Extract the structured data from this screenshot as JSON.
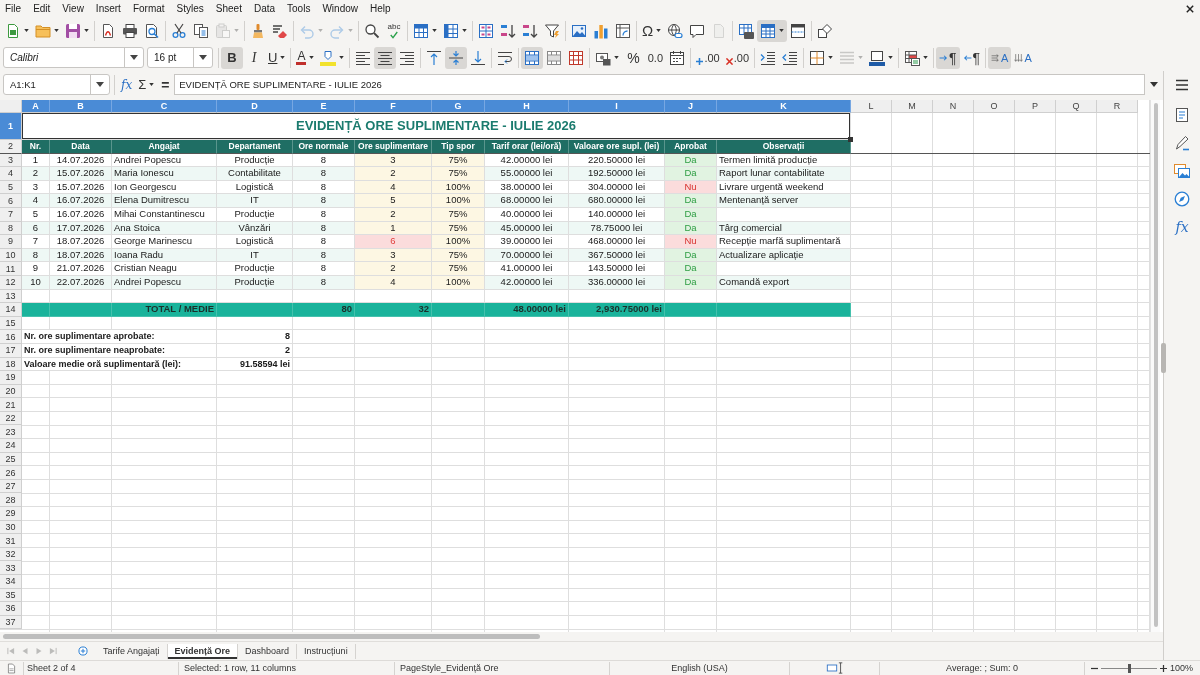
{
  "menu_bar": [
    "File",
    "Edit",
    "View",
    "Insert",
    "Format",
    "Styles",
    "Sheet",
    "Data",
    "Tools",
    "Window",
    "Help"
  ],
  "standard_toolbar": {
    "groups": [
      [
        {
          "kind": "new",
          "dropdown": true,
          "active": false,
          "disabled": false
        },
        {
          "kind": "open",
          "dropdown": true,
          "active": false,
          "disabled": false
        },
        {
          "kind": "save",
          "dropdown": true,
          "active": false,
          "disabled": false
        }
      ],
      [
        {
          "kind": "export",
          "dropdown": false,
          "active": false,
          "disabled": false
        },
        {
          "kind": "print",
          "dropdown": false,
          "active": false,
          "disabled": false
        },
        {
          "kind": "preview",
          "dropdown": false,
          "active": false,
          "disabled": false
        }
      ],
      [
        {
          "kind": "cut",
          "dropdown": false,
          "active": false,
          "disabled": false
        },
        {
          "kind": "copy",
          "dropdown": false,
          "active": false,
          "disabled": false
        },
        {
          "kind": "paste",
          "dropdown": true,
          "active": false,
          "disabled": true
        }
      ],
      [
        {
          "kind": "clone",
          "dropdown": false,
          "active": false,
          "disabled": false
        },
        {
          "kind": "clear",
          "dropdown": false,
          "active": false,
          "disabled": false
        }
      ],
      [
        {
          "kind": "undo",
          "dropdown": true,
          "active": false,
          "disabled": true
        },
        {
          "kind": "redo",
          "dropdown": true,
          "active": false,
          "disabled": true
        }
      ],
      [
        {
          "kind": "find",
          "dropdown": false,
          "active": false,
          "disabled": false
        },
        {
          "kind": "spelling",
          "label": "abc",
          "dropdown": false,
          "active": false,
          "disabled": false
        }
      ],
      [
        {
          "kind": "rows",
          "dropdown": true,
          "active": false,
          "disabled": false
        },
        {
          "kind": "columns",
          "dropdown": true,
          "active": false,
          "disabled": false
        }
      ],
      [
        {
          "kind": "sort",
          "dropdown": false,
          "active": false,
          "disabled": false
        },
        {
          "kind": "ascending",
          "dropdown": false,
          "active": false,
          "disabled": false
        },
        {
          "kind": "descending",
          "dropdown": false,
          "active": false,
          "disabled": false
        },
        {
          "kind": "filter",
          "dropdown": false,
          "active": false,
          "disabled": false
        }
      ],
      [
        {
          "kind": "image",
          "dropdown": false,
          "active": false,
          "disabled": false
        },
        {
          "kind": "chart",
          "dropdown": false,
          "active": false,
          "disabled": false
        },
        {
          "kind": "pivot",
          "dropdown": false,
          "active": false,
          "disabled": false
        }
      ],
      [
        {
          "kind": "special",
          "label": "Ω",
          "dropdown": true,
          "active": false,
          "disabled": false
        },
        {
          "kind": "link",
          "dropdown": false,
          "active": false,
          "disabled": false
        },
        {
          "kind": "comment",
          "dropdown": false,
          "active": false,
          "disabled": false
        },
        {
          "kind": "headers",
          "dropdown": false,
          "active": false,
          "disabled": true
        }
      ],
      [
        {
          "kind": "printrange",
          "dropdown": false,
          "active": false,
          "disabled": false
        },
        {
          "kind": "freeze",
          "dropdown": true,
          "active": true,
          "disabled": false
        },
        {
          "kind": "split",
          "dropdown": false,
          "active": false,
          "disabled": false
        }
      ],
      [
        {
          "kind": "shapes",
          "dropdown": false,
          "active": false,
          "disabled": false
        }
      ]
    ]
  },
  "formatting_toolbar": {
    "font_name": "Calibri",
    "font_size": "16 pt",
    "groups": [
      [
        {
          "kind": "bold",
          "label": "B",
          "dropdown": false,
          "active": true,
          "disabled": false
        },
        {
          "kind": "italic",
          "label": "I",
          "dropdown": false,
          "active": false,
          "disabled": false
        },
        {
          "kind": "underline",
          "label": "U",
          "dropdown": true,
          "active": false,
          "disabled": false
        }
      ],
      [
        {
          "kind": "fontcolor",
          "label": "A",
          "dropdown": true,
          "active": false,
          "disabled": false
        },
        {
          "kind": "highlight",
          "dropdown": true,
          "active": false,
          "disabled": false
        }
      ],
      [
        {
          "kind": "left",
          "dropdown": false,
          "active": false,
          "disabled": false
        },
        {
          "kind": "center",
          "dropdown": false,
          "active": true,
          "disabled": false
        },
        {
          "kind": "right",
          "dropdown": false,
          "active": false,
          "disabled": false
        }
      ],
      [
        {
          "kind": "top",
          "dropdown": false,
          "active": false,
          "disabled": false
        },
        {
          "kind": "middle",
          "dropdown": false,
          "active": true,
          "disabled": false
        },
        {
          "kind": "bottom",
          "dropdown": false,
          "active": false,
          "disabled": false
        }
      ],
      [
        {
          "kind": "wrap",
          "dropdown": false,
          "active": false,
          "disabled": false
        }
      ],
      [
        {
          "kind": "mergecenter",
          "dropdown": false,
          "active": true,
          "disabled": false
        },
        {
          "kind": "merge",
          "dropdown": false,
          "active": false,
          "disabled": false
        },
        {
          "kind": "unmerge",
          "dropdown": false,
          "active": false,
          "disabled": false
        }
      ],
      [
        {
          "kind": "currency",
          "dropdown": true,
          "active": false,
          "disabled": false
        },
        {
          "kind": "percent",
          "label": "%",
          "dropdown": false,
          "active": false,
          "disabled": false
        },
        {
          "kind": "number",
          "label": "0.0",
          "dropdown": false,
          "active": false,
          "disabled": false
        },
        {
          "kind": "date",
          "dropdown": false,
          "active": false,
          "disabled": false
        }
      ],
      [
        {
          "kind": "adddecimal",
          "label": ".00",
          "dropdown": false,
          "active": false,
          "disabled": false
        },
        {
          "kind": "deldecimal",
          "label": ".00",
          "dropdown": false,
          "active": false,
          "disabled": false
        }
      ],
      [
        {
          "kind": "indent",
          "dropdown": false,
          "active": false,
          "disabled": false
        },
        {
          "kind": "outdent",
          "dropdown": false,
          "active": false,
          "disabled": false
        }
      ],
      [
        {
          "kind": "borders",
          "dropdown": true,
          "active": false,
          "disabled": false
        },
        {
          "kind": "linestyle",
          "dropdown": true,
          "active": false,
          "disabled": true
        },
        {
          "kind": "bordercolor",
          "dropdown": true,
          "active": false,
          "disabled": false
        }
      ],
      [
        {
          "kind": "conditional",
          "dropdown": true,
          "active": false,
          "disabled": false
        }
      ],
      [
        {
          "kind": "ltr",
          "label": "¶",
          "dropdown": false,
          "active": true,
          "disabled": false
        },
        {
          "kind": "rtl",
          "label": "¶",
          "dropdown": false,
          "active": false,
          "disabled": false
        }
      ],
      [
        {
          "kind": "horizontal",
          "label": "A",
          "dropdown": false,
          "active": true,
          "disabled": false
        },
        {
          "kind": "vertical",
          "label": "A",
          "dropdown": false,
          "active": false,
          "disabled": false
        }
      ]
    ]
  },
  "formula_bar": {
    "name_box": "A1:K1",
    "buttons": [
      {
        "kind": "wizard",
        "label": "fx",
        "dropdown": false
      },
      {
        "kind": "sum",
        "label": "Σ",
        "dropdown": true
      },
      {
        "kind": "equals",
        "label": "=",
        "dropdown": false
      }
    ],
    "content": "EVIDENȚĂ ORE SUPLIMENTARE - IULIE 2026"
  },
  "sheet": {
    "column_headers": [
      {
        "label": "A",
        "selected": true
      },
      {
        "label": "B",
        "selected": true
      },
      {
        "label": "C",
        "selected": true
      },
      {
        "label": "D",
        "selected": true
      },
      {
        "label": "E",
        "selected": true
      },
      {
        "label": "F",
        "selected": true
      },
      {
        "label": "G",
        "selected": true
      },
      {
        "label": "H",
        "selected": true
      },
      {
        "label": "I",
        "selected": true
      },
      {
        "label": "J",
        "selected": true
      },
      {
        "label": "K",
        "selected": true
      },
      {
        "label": "L",
        "selected": false
      },
      {
        "label": "M",
        "selected": false
      },
      {
        "label": "N",
        "selected": false
      },
      {
        "label": "O",
        "selected": false
      },
      {
        "label": "P",
        "selected": false
      },
      {
        "label": "Q",
        "selected": false
      },
      {
        "label": "R",
        "selected": false
      }
    ],
    "row_headers": [
      {
        "label": "1",
        "selected": true
      },
      {
        "label": "2",
        "selected": false
      },
      {
        "label": "3",
        "selected": false
      },
      {
        "label": "4",
        "selected": false
      },
      {
        "label": "5",
        "selected": false
      },
      {
        "label": "6",
        "selected": false
      },
      {
        "label": "7",
        "selected": false
      },
      {
        "label": "8",
        "selected": false
      },
      {
        "label": "9",
        "selected": false
      },
      {
        "label": "10",
        "selected": false
      },
      {
        "label": "11",
        "selected": false
      },
      {
        "label": "12",
        "selected": false
      },
      {
        "label": "13",
        "selected": false
      },
      {
        "label": "14",
        "selected": false
      },
      {
        "label": "15",
        "selected": false
      },
      {
        "label": "16",
        "selected": false
      },
      {
        "label": "17",
        "selected": false
      },
      {
        "label": "18",
        "selected": false
      },
      {
        "label": "19",
        "selected": false
      },
      {
        "label": "20",
        "selected": false
      },
      {
        "label": "21",
        "selected": false
      },
      {
        "label": "22",
        "selected": false
      },
      {
        "label": "23",
        "selected": false
      },
      {
        "label": "24",
        "selected": false
      },
      {
        "label": "25",
        "selected": false
      },
      {
        "label": "26",
        "selected": false
      },
      {
        "label": "27",
        "selected": false
      },
      {
        "label": "28",
        "selected": false
      },
      {
        "label": "29",
        "selected": false
      },
      {
        "label": "30",
        "selected": false
      },
      {
        "label": "31",
        "selected": false
      },
      {
        "label": "32",
        "selected": false
      },
      {
        "label": "33",
        "selected": false
      },
      {
        "label": "34",
        "selected": false
      },
      {
        "label": "35",
        "selected": false
      },
      {
        "label": "36",
        "selected": false
      },
      {
        "label": "37",
        "selected": false
      }
    ],
    "title": "EVIDENȚĂ ORE SUPLIMENTARE - IULIE 2026",
    "table_header": [
      "Nr.",
      "Data",
      "Angajat",
      "Departament",
      "Ore normale",
      "Ore suplimentare",
      "Tip spor",
      "Tarif orar (lei/oră)",
      "Valoare ore supl. (lei)",
      "Aprobat",
      "Observații"
    ],
    "rows": [
      {
        "nr": "1",
        "date": "14.07.2026",
        "employee": "Andrei Popescu",
        "department": "Producție",
        "normal_hours": "8",
        "overtime_hours": "3",
        "overtime_alert": false,
        "bonus": "75%",
        "rate": "42.00000 lei",
        "value": "220.50000 lei",
        "approval": "Da",
        "approved": true,
        "notes": "Termen limită producție"
      },
      {
        "nr": "2",
        "date": "15.07.2026",
        "employee": "Maria Ionescu",
        "department": "Contabilitate",
        "normal_hours": "8",
        "overtime_hours": "2",
        "overtime_alert": false,
        "bonus": "75%",
        "rate": "55.00000 lei",
        "value": "192.50000 lei",
        "approval": "Da",
        "approved": true,
        "notes": "Raport lunar contabilitate"
      },
      {
        "nr": "3",
        "date": "15.07.2026",
        "employee": "Ion Georgescu",
        "department": "Logistică",
        "normal_hours": "8",
        "overtime_hours": "4",
        "overtime_alert": false,
        "bonus": "100%",
        "rate": "38.00000 lei",
        "value": "304.00000 lei",
        "approval": "Nu",
        "approved": false,
        "notes": "Livrare urgentă weekend"
      },
      {
        "nr": "4",
        "date": "16.07.2026",
        "employee": "Elena Dumitrescu",
        "department": "IT",
        "normal_hours": "8",
        "overtime_hours": "5",
        "overtime_alert": false,
        "bonus": "100%",
        "rate": "68.00000 lei",
        "value": "680.00000 lei",
        "approval": "Da",
        "approved": true,
        "notes": "Mentenanță server"
      },
      {
        "nr": "5",
        "date": "16.07.2026",
        "employee": "Mihai Constantinescu",
        "department": "Producție",
        "normal_hours": "8",
        "overtime_hours": "2",
        "overtime_alert": false,
        "bonus": "75%",
        "rate": "40.00000 lei",
        "value": "140.00000 lei",
        "approval": "Da",
        "approved": true
      },
      {
        "nr": "6",
        "date": "17.07.2026",
        "employee": "Ana Stoica",
        "department": "Vânzări",
        "normal_hours": "8",
        "overtime_hours": "1",
        "overtime_alert": false,
        "bonus": "75%",
        "rate": "45.00000 lei",
        "value": "78.75000 lei",
        "approval": "Da",
        "approved": true,
        "notes": "Târg comercial"
      },
      {
        "nr": "7",
        "date": "18.07.2026",
        "employee": "George Marinescu",
        "department": "Logistică",
        "normal_hours": "8",
        "overtime_hours": "6",
        "overtime_alert": true,
        "bonus": "100%",
        "rate": "39.00000 lei",
        "value": "468.00000 lei",
        "approval": "Nu",
        "approved": false,
        "notes": "Recepție marfă suplimentară"
      },
      {
        "nr": "8",
        "date": "18.07.2026",
        "employee": "Ioana Radu",
        "department": "IT",
        "normal_hours": "8",
        "overtime_hours": "3",
        "overtime_alert": false,
        "bonus": "75%",
        "rate": "70.00000 lei",
        "value": "367.50000 lei",
        "approval": "Da",
        "approved": true,
        "notes": "Actualizare aplicație"
      },
      {
        "nr": "9",
        "date": "21.07.2026",
        "employee": "Cristian Neagu",
        "department": "Producție",
        "normal_hours": "8",
        "overtime_hours": "2",
        "overtime_alert": false,
        "bonus": "75%",
        "rate": "41.00000 lei",
        "value": "143.50000 lei",
        "approval": "Da",
        "approved": true
      },
      {
        "nr": "10",
        "date": "22.07.2026",
        "employee": "Andrei Popescu",
        "department": "Producție",
        "normal_hours": "8",
        "overtime_hours": "4",
        "overtime_alert": false,
        "bonus": "100%",
        "rate": "42.00000 lei",
        "value": "336.00000 lei",
        "approval": "Da",
        "approved": true,
        "notes": "Comandă export"
      }
    ],
    "total": {
      "label": "TOTAL / MEDIE",
      "normal_hours": "80",
      "overtime_hours": "32",
      "rate": "48.00000 lei",
      "value": "2,930.75000 lei"
    },
    "summary": [
      {
        "label": "Nr. ore suplimentare aprobate:",
        "value": "8"
      },
      {
        "label": "Nr. ore suplimentare neaprobate:",
        "value": "2"
      },
      {
        "label": "Valoare medie oră suplimentară (lei):",
        "value": "91.58594 lei"
      }
    ]
  },
  "sheet_navigation": [
    {
      "kind": "first",
      "disabled": true
    },
    {
      "kind": "previous",
      "disabled": true
    },
    {
      "kind": "next",
      "disabled": true
    },
    {
      "kind": "last",
      "disabled": true
    },
    {
      "kind": "add",
      "disabled": false
    }
  ],
  "sheet_tabs": [
    {
      "label": "Tarife Angajați",
      "selected": false
    },
    {
      "label": "Evidență Ore",
      "selected": true
    },
    {
      "label": "Dashboard",
      "selected": false
    },
    {
      "label": "Instrucțiuni",
      "selected": false
    }
  ],
  "sidebar": [
    {
      "kind": "menu"
    },
    {
      "kind": "properties"
    },
    {
      "kind": "styles"
    },
    {
      "kind": "gallery"
    },
    {
      "kind": "navigator"
    },
    {
      "kind": "functions",
      "label": "fx"
    }
  ],
  "status_bar": {
    "sheet": "Sheet 2 of 4",
    "selection": "Selected: 1 row, 11 columns",
    "page_style": "PageStyle_Evidență Ore",
    "language": "English (USA)",
    "statistics": "Average: ; Sum: 0",
    "zoom": {
      "level": 0.5,
      "reading": "100%"
    }
  }
}
